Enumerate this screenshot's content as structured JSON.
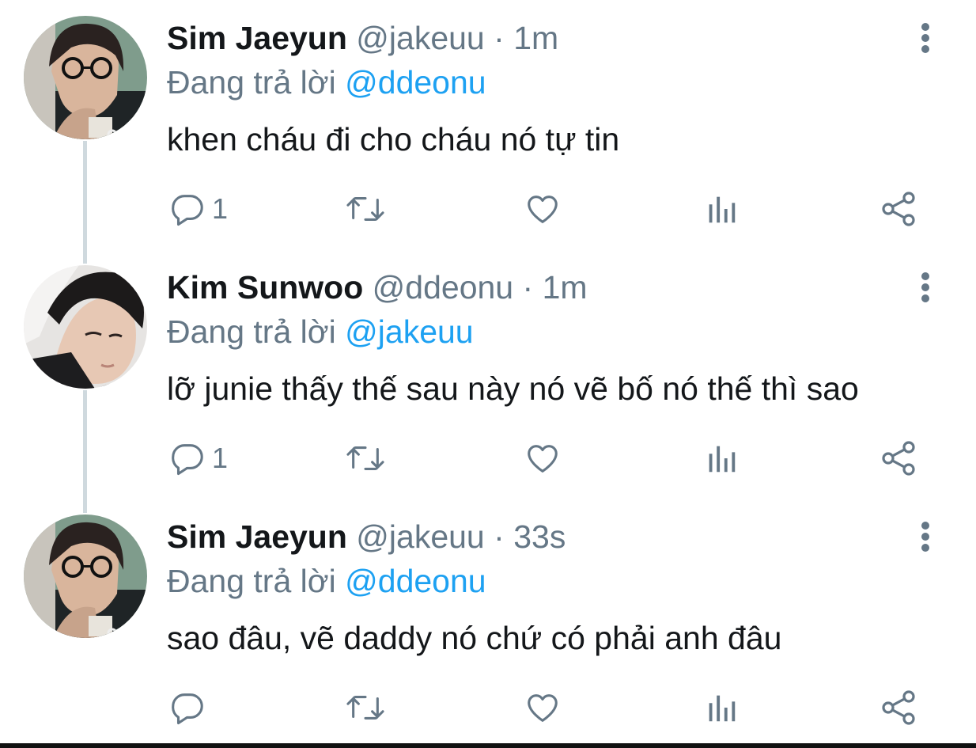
{
  "colors": {
    "name": "#14171a",
    "secondary": "#657786",
    "mention": "#1da1f2",
    "thread_line": "#cfd9de"
  },
  "tweets": [
    {
      "display_name": "Sim Jaeyun",
      "handle": "@jakeuu",
      "separator": "·",
      "time": "1m",
      "reply_prefix": "Đang trả lời",
      "reply_to": "@ddeonu",
      "text": "khen cháu đi cho cháu nó tự tin",
      "reply_count": "1",
      "avatar": "avatar-glasses"
    },
    {
      "display_name": "Kim Sunwoo",
      "handle": "@ddeonu",
      "separator": "·",
      "time": "1m",
      "reply_prefix": "Đang trả lời",
      "reply_to": "@jakeuu",
      "text": "lỡ junie thấy thế sau này nó vẽ bố nó thế thì sao",
      "reply_count": "1",
      "avatar": "avatar-pillow"
    },
    {
      "display_name": "Sim Jaeyun",
      "handle": "@jakeuu",
      "separator": "·",
      "time": "33s",
      "reply_prefix": "Đang trả lời",
      "reply_to": "@ddeonu",
      "text": "sao đâu, vẽ daddy nó chứ có phải anh đâu",
      "reply_count": "",
      "avatar": "avatar-glasses"
    }
  ],
  "icons": {
    "more": "more-vertical-icon",
    "reply": "reply-icon",
    "retweet": "retweet-icon",
    "like": "heart-icon",
    "analytics": "analytics-icon",
    "share": "share-icon"
  }
}
